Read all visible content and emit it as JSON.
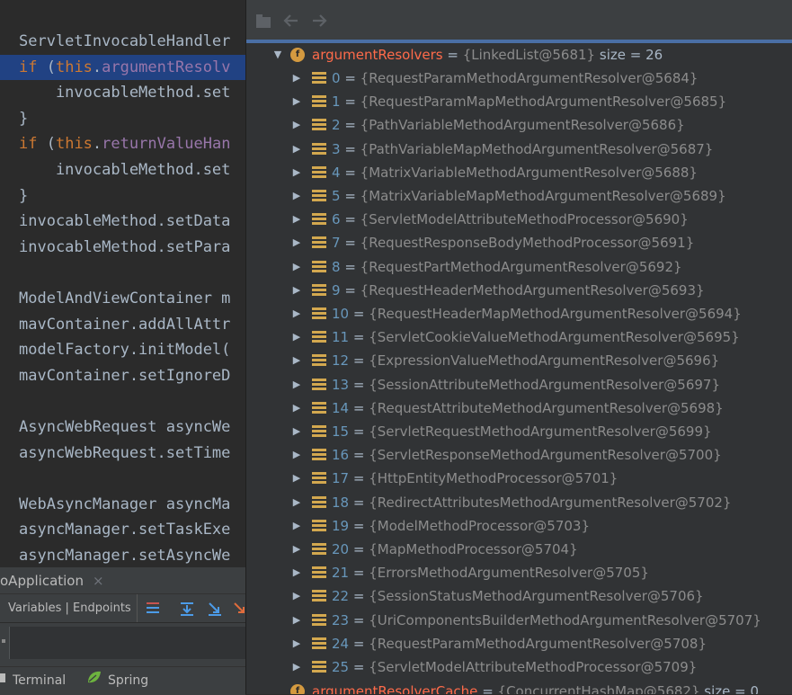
{
  "colors": {
    "accent": "#4a6fa5",
    "field_name": "#ff6b4a",
    "index": "#6897bb",
    "value": "#8c8c8c",
    "keyword": "#cc7832",
    "field": "#9876aa"
  },
  "editor": {
    "lines": [
      {
        "parts": [
          {
            "t": "ServletInvocableHandler",
            "c": ""
          }
        ]
      },
      {
        "parts": [
          {
            "t": "if",
            "c": "kw"
          },
          {
            "t": " (",
            "c": ""
          },
          {
            "t": "this",
            "c": "kw"
          },
          {
            "t": ".",
            "c": ""
          },
          {
            "t": "argumentResolv",
            "c": "fld"
          }
        ],
        "highlight": true
      },
      {
        "parts": [
          {
            "t": "    invocableMethod.set",
            "c": ""
          }
        ]
      },
      {
        "parts": [
          {
            "t": "}",
            "c": ""
          }
        ]
      },
      {
        "parts": [
          {
            "t": "if",
            "c": "kw"
          },
          {
            "t": " (",
            "c": ""
          },
          {
            "t": "this",
            "c": "kw"
          },
          {
            "t": ".",
            "c": ""
          },
          {
            "t": "returnValueHan",
            "c": "fld"
          }
        ]
      },
      {
        "parts": [
          {
            "t": "    invocableMethod.set",
            "c": ""
          }
        ]
      },
      {
        "parts": [
          {
            "t": "}",
            "c": ""
          }
        ]
      },
      {
        "parts": [
          {
            "t": "invocableMethod.setData",
            "c": ""
          }
        ]
      },
      {
        "parts": [
          {
            "t": "invocableMethod.setPara",
            "c": ""
          }
        ]
      },
      {
        "parts": [
          {
            "t": "",
            "c": ""
          }
        ]
      },
      {
        "parts": [
          {
            "t": "ModelAndViewContainer m",
            "c": ""
          }
        ]
      },
      {
        "parts": [
          {
            "t": "mavContainer.addAllAttr",
            "c": ""
          }
        ]
      },
      {
        "parts": [
          {
            "t": "modelFactory.initModel(",
            "c": ""
          }
        ]
      },
      {
        "parts": [
          {
            "t": "mavContainer.setIgnoreD",
            "c": ""
          }
        ]
      },
      {
        "parts": [
          {
            "t": "",
            "c": ""
          }
        ]
      },
      {
        "parts": [
          {
            "t": "AsyncWebRequest asyncWe",
            "c": ""
          }
        ]
      },
      {
        "parts": [
          {
            "t": "asyncWebRequest.setTime",
            "c": ""
          }
        ]
      },
      {
        "parts": [
          {
            "t": "",
            "c": ""
          }
        ]
      },
      {
        "parts": [
          {
            "t": "WebAsyncManager asyncMa",
            "c": ""
          }
        ]
      },
      {
        "parts": [
          {
            "t": "asyncManager.setTaskExe",
            "c": ""
          }
        ]
      },
      {
        "parts": [
          {
            "t": "asyncManager.setAsyncWe",
            "c": ""
          }
        ]
      }
    ]
  },
  "tool_tab": {
    "label": "oApplication",
    "close": "×"
  },
  "debug_toolbar": {
    "tabs_label": "Variables | Endpoints",
    "icons": [
      "step-list-icon",
      "step-over-icon",
      "step-into-icon",
      "force-step-icon"
    ]
  },
  "status_bar": {
    "terminal_label": "Terminal",
    "spring_label": "Spring"
  },
  "popup_toolbar": {
    "icons": [
      "navigate-icon",
      "back-icon",
      "forward-icon"
    ]
  },
  "tree": {
    "root": {
      "name": "argumentResolvers",
      "eq": " = ",
      "value": "{LinkedList@5681}",
      "size": "size = 26"
    },
    "items": [
      {
        "index": "0",
        "value": "{RequestParamMethodArgumentResolver@5684}"
      },
      {
        "index": "1",
        "value": "{RequestParamMapMethodArgumentResolver@5685}"
      },
      {
        "index": "2",
        "value": "{PathVariableMethodArgumentResolver@5686}"
      },
      {
        "index": "3",
        "value": "{PathVariableMapMethodArgumentResolver@5687}"
      },
      {
        "index": "4",
        "value": "{MatrixVariableMethodArgumentResolver@5688}"
      },
      {
        "index": "5",
        "value": "{MatrixVariableMapMethodArgumentResolver@5689}"
      },
      {
        "index": "6",
        "value": "{ServletModelAttributeMethodProcessor@5690}"
      },
      {
        "index": "7",
        "value": "{RequestResponseBodyMethodProcessor@5691}"
      },
      {
        "index": "8",
        "value": "{RequestPartMethodArgumentResolver@5692}"
      },
      {
        "index": "9",
        "value": "{RequestHeaderMethodArgumentResolver@5693}"
      },
      {
        "index": "10",
        "value": "{RequestHeaderMapMethodArgumentResolver@5694}"
      },
      {
        "index": "11",
        "value": "{ServletCookieValueMethodArgumentResolver@5695}"
      },
      {
        "index": "12",
        "value": "{ExpressionValueMethodArgumentResolver@5696}"
      },
      {
        "index": "13",
        "value": "{SessionAttributeMethodArgumentResolver@5697}"
      },
      {
        "index": "14",
        "value": "{RequestAttributeMethodArgumentResolver@5698}"
      },
      {
        "index": "15",
        "value": "{ServletRequestMethodArgumentResolver@5699}"
      },
      {
        "index": "16",
        "value": "{ServletResponseMethodArgumentResolver@5700}"
      },
      {
        "index": "17",
        "value": "{HttpEntityMethodProcessor@5701}"
      },
      {
        "index": "18",
        "value": "{RedirectAttributesMethodArgumentResolver@5702}"
      },
      {
        "index": "19",
        "value": "{ModelMethodProcessor@5703}"
      },
      {
        "index": "20",
        "value": "{MapMethodProcessor@5704}"
      },
      {
        "index": "21",
        "value": "{ErrorsMethodArgumentResolver@5705}"
      },
      {
        "index": "22",
        "value": "{SessionStatusMethodArgumentResolver@5706}"
      },
      {
        "index": "23",
        "value": "{UriComponentsBuilderMethodArgumentResolver@5707}"
      },
      {
        "index": "24",
        "value": "{RequestParamMethodArgumentResolver@5708}"
      },
      {
        "index": "25",
        "value": "{ServletModelAttributeMethodProcessor@5709}"
      }
    ],
    "next": {
      "name": "argumentResolverCache",
      "eq": " = ",
      "value": "{ConcurrentHashMap@5682}",
      "size": "size = 0"
    }
  }
}
